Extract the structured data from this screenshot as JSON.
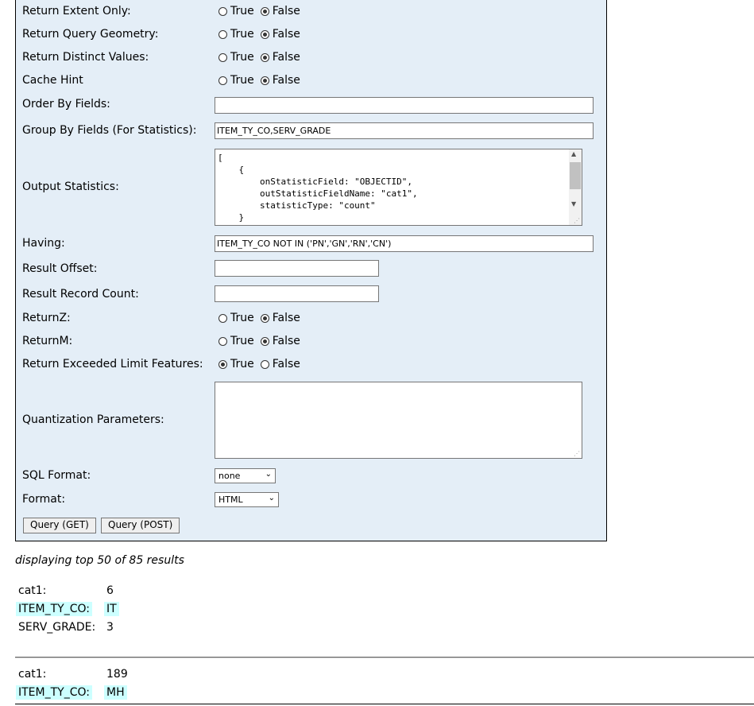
{
  "form": {
    "return_extent_only": {
      "label": "Return Extent Only:",
      "true_label": "True",
      "false_label": "False",
      "selected": "False"
    },
    "return_query_geometry": {
      "label": "Return Query Geometry:",
      "true_label": "True",
      "false_label": "False",
      "selected": "False"
    },
    "return_distinct_values": {
      "label": "Return Distinct Values:",
      "true_label": "True",
      "false_label": "False",
      "selected": "False"
    },
    "cache_hint": {
      "label": "Cache Hint",
      "true_label": "True",
      "false_label": "False",
      "selected": "False"
    },
    "order_by_fields": {
      "label": "Order By Fields:",
      "value": ""
    },
    "group_by_fields": {
      "label": "Group By Fields (For Statistics):",
      "value": "ITEM_TY_CO,SERV_GRADE"
    },
    "output_statistics": {
      "label": "Output Statistics:",
      "value": "[\n    {\n        onStatisticField: \"OBJECTID\",\n        outStatisticFieldName: \"cat1\",\n        statisticType: \"count\"\n    }"
    },
    "having": {
      "label": "Having:",
      "value": "ITEM_TY_CO NOT IN ('PN','GN','RN','CN')"
    },
    "result_offset": {
      "label": "Result Offset:",
      "value": ""
    },
    "result_record_count": {
      "label": "Result Record Count:",
      "value": ""
    },
    "return_z": {
      "label": "ReturnZ:",
      "true_label": "True",
      "false_label": "False",
      "selected": "False"
    },
    "return_m": {
      "label": "ReturnM:",
      "true_label": "True",
      "false_label": "False",
      "selected": "False"
    },
    "return_exceeded_limit": {
      "label": "Return Exceeded Limit Features:",
      "true_label": "True",
      "false_label": "False",
      "selected": "True"
    },
    "quantization_parameters": {
      "label": "Quantization Parameters:",
      "value": ""
    },
    "sql_format": {
      "label": "SQL Format:",
      "selected": "none"
    },
    "format": {
      "label": "Format:",
      "selected": "HTML"
    },
    "query_get_label": "Query (GET)",
    "query_post_label": "Query (POST)"
  },
  "results": {
    "summary": "displaying top 50 of 85 results",
    "records": [
      [
        {
          "key": "cat1:",
          "value": "6",
          "highlight": false
        },
        {
          "key": "ITEM_TY_CO:",
          "value": "IT",
          "highlight": true
        },
        {
          "key": "SERV_GRADE:",
          "value": "3",
          "highlight": false
        }
      ],
      [
        {
          "key": "cat1:",
          "value": "189",
          "highlight": false
        },
        {
          "key": "ITEM_TY_CO:",
          "value": "MH",
          "highlight": true
        }
      ]
    ]
  },
  "colors": {
    "panel_bg": "#E4EEF7",
    "highlight": "#CCFFFF"
  }
}
